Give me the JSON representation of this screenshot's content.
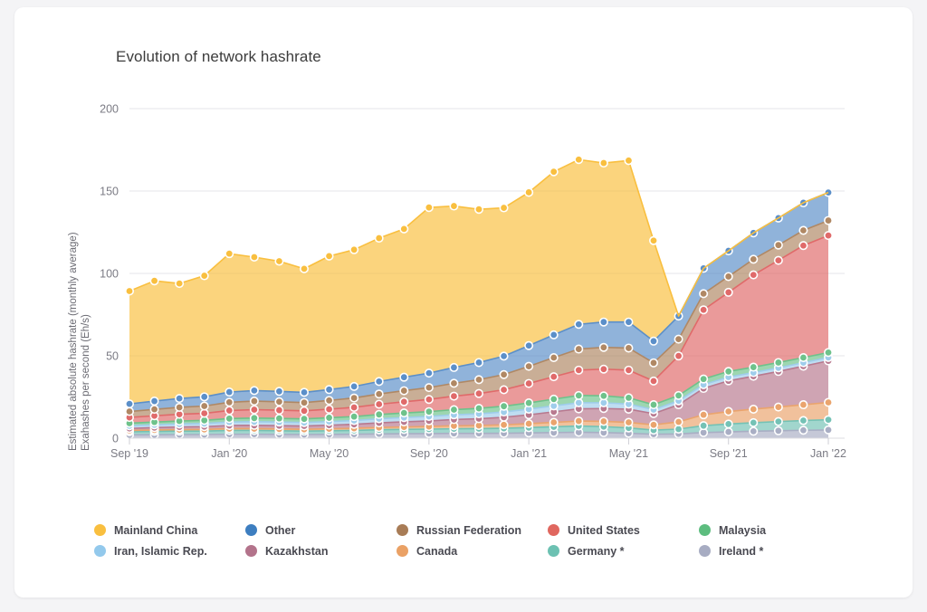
{
  "card": {
    "background": "#ffffff",
    "page_background": "#f4f4f6"
  },
  "chart_data": {
    "type": "area",
    "stacked": true,
    "title": "Evolution of network hashrate",
    "xlabel": "",
    "ylabel": "Estimated absolute hashrate (monthly average) Exahashes per second (Eh/s)",
    "ylabel_line1": "Estimated absolute hashrate (monthly average)",
    "ylabel_line2": "Exahashes per second (Eh/s)",
    "ylim": [
      0,
      200
    ],
    "yticks": [
      0,
      50,
      100,
      150,
      200
    ],
    "ytick_labels": [
      "0",
      "50",
      "100",
      "150",
      "200"
    ],
    "grid": true,
    "legend_position": "bottom",
    "markers": true,
    "x": [
      "Sep '19",
      "Oct '19",
      "Nov '19",
      "Dec '19",
      "Jan '20",
      "Feb '20",
      "Mar '20",
      "Apr '20",
      "May '20",
      "Jun '20",
      "Jul '20",
      "Aug '20",
      "Sep '20",
      "Oct '20",
      "Nov '20",
      "Dec '20",
      "Jan '21",
      "Feb '21",
      "Mar '21",
      "Apr '21",
      "May '21",
      "Jun '21",
      "Jul '21",
      "Aug '21",
      "Sep '21",
      "Oct '21",
      "Nov '21",
      "Dec '21",
      "Jan '22"
    ],
    "xtick_labels": [
      "Sep '19",
      "Jan '20",
      "May '20",
      "Sep '20",
      "Jan '21",
      "May '21",
      "Sep '21",
      "Jan '22"
    ],
    "xtick_indices": [
      0,
      4,
      8,
      12,
      16,
      20,
      24,
      28
    ],
    "series": [
      {
        "name": "Ireland *",
        "color": "#a9aec4",
        "values": [
          2.0,
          2.1,
          2.2,
          2.2,
          2.4,
          2.4,
          2.3,
          2.2,
          2.3,
          2.4,
          2.6,
          2.7,
          2.8,
          2.9,
          2.9,
          3.0,
          3.2,
          3.4,
          3.6,
          3.4,
          3.0,
          2.4,
          2.6,
          3.4,
          3.8,
          4.2,
          4.5,
          4.8,
          5.0
        ]
      },
      {
        "name": "Germany *",
        "color": "#74c2b5",
        "values": [
          1.9,
          2.0,
          2.1,
          2.1,
          2.3,
          2.3,
          2.2,
          2.1,
          2.2,
          2.3,
          2.5,
          2.6,
          2.7,
          2.8,
          2.9,
          3.0,
          3.2,
          3.5,
          3.8,
          3.6,
          3.2,
          2.5,
          2.9,
          4.2,
          4.8,
          5.2,
          5.6,
          5.9,
          6.2
        ]
      },
      {
        "name": "Canada",
        "color": "#eaa46d",
        "values": [
          0.8,
          0.9,
          0.9,
          1.0,
          1.1,
          1.1,
          1.1,
          1.1,
          1.2,
          1.3,
          1.4,
          1.5,
          1.6,
          1.8,
          1.9,
          2.1,
          2.4,
          2.7,
          3.0,
          3.2,
          3.4,
          3.2,
          4.4,
          6.6,
          7.6,
          8.2,
          8.8,
          9.6,
          10.5
        ]
      },
      {
        "name": "Kazakhstan",
        "color": "#b8798f",
        "values": [
          1.2,
          1.4,
          1.6,
          1.7,
          1.9,
          2.0,
          2.0,
          2.0,
          2.2,
          2.4,
          2.8,
          3.1,
          3.4,
          3.8,
          4.1,
          4.6,
          5.4,
          6.4,
          7.4,
          7.8,
          8.0,
          6.8,
          10.4,
          16.0,
          18.6,
          20.0,
          21.6,
          23.4,
          25.2
        ]
      },
      {
        "name": "Iran, Islamic Rep.",
        "color": "#9fcdeb",
        "values": [
          1.6,
          1.7,
          1.8,
          1.9,
          2.1,
          2.2,
          2.2,
          2.1,
          2.2,
          2.3,
          2.5,
          2.6,
          2.7,
          2.9,
          3.0,
          3.2,
          3.4,
          3.6,
          3.7,
          3.5,
          3.1,
          2.4,
          2.4,
          2.3,
          2.3,
          2.2,
          2.2,
          2.1,
          2.1
        ]
      },
      {
        "name": "Malaysia",
        "color": "#6ec28b",
        "values": [
          1.6,
          1.7,
          1.8,
          1.9,
          2.1,
          2.2,
          2.2,
          2.2,
          2.3,
          2.4,
          2.6,
          2.8,
          2.9,
          3.1,
          3.3,
          3.5,
          3.8,
          4.1,
          4.4,
          4.2,
          3.8,
          3.0,
          3.2,
          3.4,
          3.4,
          3.3,
          3.2,
          3.1,
          3.0
        ]
      },
      {
        "name": "United States",
        "color": "#e06a6a",
        "values": [
          3.5,
          3.8,
          4.1,
          4.3,
          4.9,
          5.1,
          5.0,
          4.9,
          5.2,
          5.6,
          6.2,
          6.8,
          7.4,
          8.2,
          9.0,
          10.0,
          11.8,
          13.6,
          15.4,
          16.2,
          16.8,
          14.4,
          24.0,
          42.0,
          48.0,
          56.0,
          62.0,
          68.0,
          71.0
        ]
      },
      {
        "name": "Russian Federation",
        "color": "#b08864",
        "values": [
          3.6,
          3.9,
          4.2,
          4.4,
          5.0,
          5.2,
          5.1,
          5.0,
          5.3,
          5.7,
          6.2,
          6.7,
          7.2,
          7.8,
          8.4,
          9.2,
          10.4,
          11.6,
          12.8,
          13.2,
          13.4,
          11.0,
          10.2,
          9.8,
          9.6,
          9.5,
          9.3,
          9.2,
          9.1
        ]
      },
      {
        "name": "Other",
        "color": "#5b8fc9",
        "values": [
          4.6,
          5.0,
          5.4,
          5.6,
          6.2,
          6.4,
          6.3,
          6.2,
          6.6,
          7.0,
          7.6,
          8.2,
          8.8,
          9.6,
          10.4,
          11.2,
          12.6,
          13.8,
          15.0,
          15.4,
          15.8,
          13.2,
          14.0,
          15.4,
          15.6,
          16.0,
          16.4,
          16.8,
          17.0
        ]
      },
      {
        "name": "Mainland China",
        "color": "#f9bf3f",
        "values": [
          68.5,
          73.0,
          69.8,
          73.5,
          84.0,
          81.0,
          79.0,
          75.0,
          81.0,
          83.0,
          87.0,
          90.0,
          100.5,
          98.0,
          93.0,
          90.0,
          93.0,
          99.0,
          100.0,
          96.5,
          98.0,
          61.0,
          0.0,
          0.0,
          0.0,
          0.0,
          0.0,
          0.0,
          0.0
        ]
      }
    ],
    "totals": [
      89.3,
      95.5,
      91.9,
      96.6,
      112.0,
      110.0,
      107.4,
      102.8,
      110.5,
      114.4,
      121.4,
      127.0,
      139.6,
      141.9,
      141.9,
      142.8,
      158.2,
      172.7,
      185.1,
      183.0,
      185.5,
      122.3,
      74.1,
      103.1,
      113.7,
      124.6,
      133.6,
      143.9,
      149.1
    ],
    "footnote_marker": "*"
  },
  "legend": {
    "rows": [
      [
        {
          "label": "Mainland China",
          "color": "#f9bf3f"
        },
        {
          "label": "Other",
          "color": "#3d7ec0"
        },
        {
          "label": "Russian Federation",
          "color": "#a87c56"
        },
        {
          "label": "United States",
          "color": "#e0675f"
        },
        {
          "label": "Malaysia",
          "color": "#5dbd7f"
        }
      ],
      [
        {
          "label": "Iran, Islamic Rep.",
          "color": "#93c9ec"
        },
        {
          "label": "Kazakhstan",
          "color": "#b3738b"
        },
        {
          "label": "Canada",
          "color": "#eaa165"
        },
        {
          "label": "Germany *",
          "color": "#6cc1b2"
        },
        {
          "label": "Ireland *",
          "color": "#a7acc2"
        }
      ]
    ]
  }
}
